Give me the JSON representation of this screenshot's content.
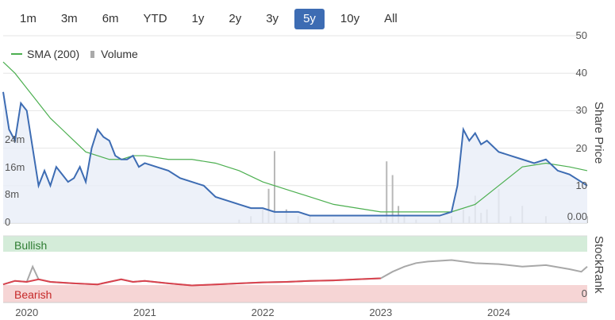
{
  "range_selector": {
    "buttons": [
      "1m",
      "3m",
      "6m",
      "YTD",
      "1y",
      "2y",
      "3y",
      "5y",
      "10y",
      "All"
    ],
    "active": "5y"
  },
  "legend": {
    "sma_label": "SMA (200)",
    "volume_label": "Volume"
  },
  "axes": {
    "share_price_title": "Share Price",
    "stockrank_title": "StockRank",
    "price_ticks": [
      "50",
      "40",
      "30",
      "20",
      "10"
    ],
    "volume_ticks": [
      "24m",
      "16m",
      "8m",
      "0"
    ],
    "volume_right_zero": "0.00",
    "stockrank_zero": "0",
    "year_ticks": [
      "2020",
      "2021",
      "2022",
      "2023",
      "2024"
    ]
  },
  "bands": {
    "bullish": "Bullish",
    "bearish": "Bearish"
  },
  "colors": {
    "price_line": "#3d6cb3",
    "sma_line": "#4caf50",
    "volume_bars": "#b8b8b8",
    "bullish_band": "#d4ecd9",
    "bearish_band": "#f6d5d5",
    "rank_bearish_line": "#d9434e",
    "rank_line": "#a8a8a8",
    "active_button": "#3d6cb3"
  },
  "chart_data": [
    {
      "type": "line",
      "title": "",
      "ylabel": "Share Price",
      "ylim": [
        0,
        50
      ],
      "x_ticks": [
        "2020",
        "2021",
        "2022",
        "2023",
        "2024"
      ],
      "series": [
        {
          "name": "Price",
          "x": [
            2019.8,
            2019.85,
            2019.9,
            2019.95,
            2020.0,
            2020.05,
            2020.1,
            2020.15,
            2020.2,
            2020.25,
            2020.3,
            2020.35,
            2020.4,
            2020.45,
            2020.5,
            2020.55,
            2020.6,
            2020.65,
            2020.7,
            2020.75,
            2020.8,
            2020.85,
            2020.9,
            2020.95,
            2021.0,
            2021.1,
            2021.2,
            2021.3,
            2021.4,
            2021.5,
            2021.6,
            2021.7,
            2021.8,
            2021.9,
            2022.0,
            2022.1,
            2022.2,
            2022.3,
            2022.4,
            2022.5,
            2022.6,
            2022.7,
            2022.8,
            2022.9,
            2023.0,
            2023.1,
            2023.2,
            2023.3,
            2023.4,
            2023.5,
            2023.6,
            2023.65,
            2023.7,
            2023.75,
            2023.8,
            2023.85,
            2023.9,
            2024.0,
            2024.1,
            2024.2,
            2024.3,
            2024.4,
            2024.5,
            2024.6,
            2024.7,
            2024.75
          ],
          "values": [
            35,
            25,
            22,
            32,
            30,
            20,
            10,
            14,
            10,
            15,
            13,
            11,
            12,
            15,
            11,
            20,
            25,
            23,
            22,
            18,
            17,
            17,
            18,
            15,
            16,
            15,
            14,
            12,
            11,
            10,
            7,
            6,
            5,
            4,
            4,
            3,
            3,
            3,
            2,
            2,
            2,
            2,
            2,
            2,
            2,
            2,
            2,
            2,
            2,
            2,
            3,
            10,
            25,
            22,
            24,
            21,
            22,
            19,
            18,
            17,
            16,
            17,
            14,
            13,
            11,
            10
          ]
        },
        {
          "name": "SMA (200)",
          "x": [
            2019.8,
            2019.9,
            2020.0,
            2020.1,
            2020.2,
            2020.3,
            2020.4,
            2020.5,
            2020.6,
            2020.7,
            2020.8,
            2020.9,
            2021.0,
            2021.2,
            2021.4,
            2021.6,
            2021.8,
            2022.0,
            2022.2,
            2022.4,
            2022.6,
            2022.8,
            2023.0,
            2023.2,
            2023.4,
            2023.6,
            2023.8,
            2024.0,
            2024.2,
            2024.4,
            2024.6,
            2024.75
          ],
          "values": [
            43,
            40,
            36,
            32,
            28,
            25,
            22,
            19,
            18,
            17,
            17,
            18,
            18,
            17,
            17,
            16,
            14,
            11,
            9,
            7,
            5,
            4,
            3,
            3,
            3,
            3,
            5,
            10,
            15,
            16,
            15,
            14
          ]
        }
      ]
    },
    {
      "type": "bar",
      "title": "",
      "ylabel": "Volume",
      "ylim": [
        0,
        28
      ],
      "note_unit": "m",
      "series": [
        {
          "name": "Volume",
          "x": [
            2021.8,
            2021.9,
            2022.0,
            2022.05,
            2022.1,
            2022.2,
            2022.3,
            2022.4,
            2022.6,
            2023.0,
            2023.05,
            2023.1,
            2023.15,
            2023.2,
            2023.3,
            2023.5,
            2023.6,
            2023.7,
            2023.75,
            2023.8,
            2023.85,
            2023.9,
            2024.0,
            2024.1,
            2024.2,
            2024.4,
            2024.6,
            2024.75
          ],
          "values": [
            1,
            2,
            4,
            10,
            21,
            4,
            2,
            2,
            1,
            1,
            18,
            14,
            5,
            2,
            1,
            1,
            2,
            4,
            2,
            8,
            3,
            4,
            10,
            2,
            5,
            2,
            1,
            2
          ]
        }
      ]
    },
    {
      "type": "line",
      "title": "",
      "ylabel": "StockRank",
      "ylim": [
        0,
        100
      ],
      "series": [
        {
          "name": "StockRank",
          "x": [
            2019.8,
            2019.9,
            2020.0,
            2020.05,
            2020.1,
            2020.2,
            2020.4,
            2020.6,
            2020.8,
            2020.9,
            2021.0,
            2021.2,
            2021.4,
            2021.6,
            2021.8,
            2022.0,
            2022.2,
            2022.4,
            2022.6,
            2022.8,
            2023.0,
            2023.1,
            2023.2,
            2023.3,
            2023.4,
            2023.6,
            2023.8,
            2024.0,
            2024.2,
            2024.4,
            2024.6,
            2024.7,
            2024.75
          ],
          "values": [
            20,
            27,
            25,
            55,
            30,
            25,
            22,
            20,
            30,
            25,
            27,
            22,
            18,
            20,
            22,
            24,
            25,
            27,
            28,
            30,
            32,
            45,
            55,
            62,
            65,
            68,
            62,
            60,
            55,
            58,
            50,
            45,
            55
          ]
        }
      ]
    }
  ]
}
